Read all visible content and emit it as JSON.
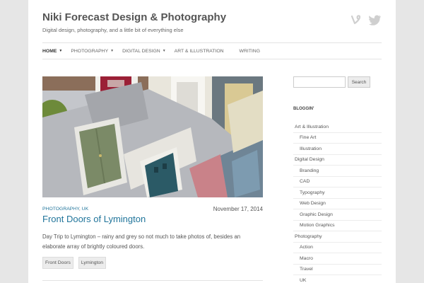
{
  "site": {
    "title": "Niki Forecast Design & Photography",
    "description": "Digital design, photography, and a little bit of everything else"
  },
  "social": [
    {
      "icon": "vine-icon",
      "color": "#cfcfcf"
    },
    {
      "icon": "twitter-icon",
      "color": "#cfcfcf"
    }
  ],
  "nav": {
    "items": [
      {
        "label": "Home",
        "dropdown": true,
        "active": true
      },
      {
        "label": "Photography",
        "dropdown": true
      },
      {
        "label": "Digital Design",
        "dropdown": true
      },
      {
        "label": "Art & Illustration",
        "dropdown": false
      },
      {
        "label": "Writing",
        "dropdown": false
      }
    ]
  },
  "post": {
    "categories": [
      "PHOTOGRAPHY",
      "UK"
    ],
    "date": "November 17, 2014",
    "title": "Front Doors of Lymington",
    "excerpt": "Day Trip to Lymington – rainy and grey so not much to take photos of, besides an elaborate array of brightly coloured doors.",
    "tags": [
      "Front Doors",
      "Lymington"
    ],
    "link_color": "#21759b"
  },
  "sidebar": {
    "search": {
      "placeholder": "",
      "button_label": "Search"
    },
    "widget_title": "BLOGGIN'",
    "categories": [
      {
        "label": "Art & Illustration",
        "level": 0
      },
      {
        "label": "Fine Art",
        "level": 1
      },
      {
        "label": "Illustration",
        "level": 1
      },
      {
        "label": "Digital Design",
        "level": 0
      },
      {
        "label": "Branding",
        "level": 1
      },
      {
        "label": "CAD",
        "level": 1
      },
      {
        "label": "Typography",
        "level": 1
      },
      {
        "label": "Web Design",
        "level": 1
      },
      {
        "label": "Graphic Design",
        "level": 1
      },
      {
        "label": "Motion Graphics",
        "level": 1
      },
      {
        "label": "Photography",
        "level": 0
      },
      {
        "label": "Action",
        "level": 1
      },
      {
        "label": "Macro",
        "level": 1
      },
      {
        "label": "Travel",
        "level": 1
      },
      {
        "label": "UK",
        "level": 1
      }
    ]
  }
}
